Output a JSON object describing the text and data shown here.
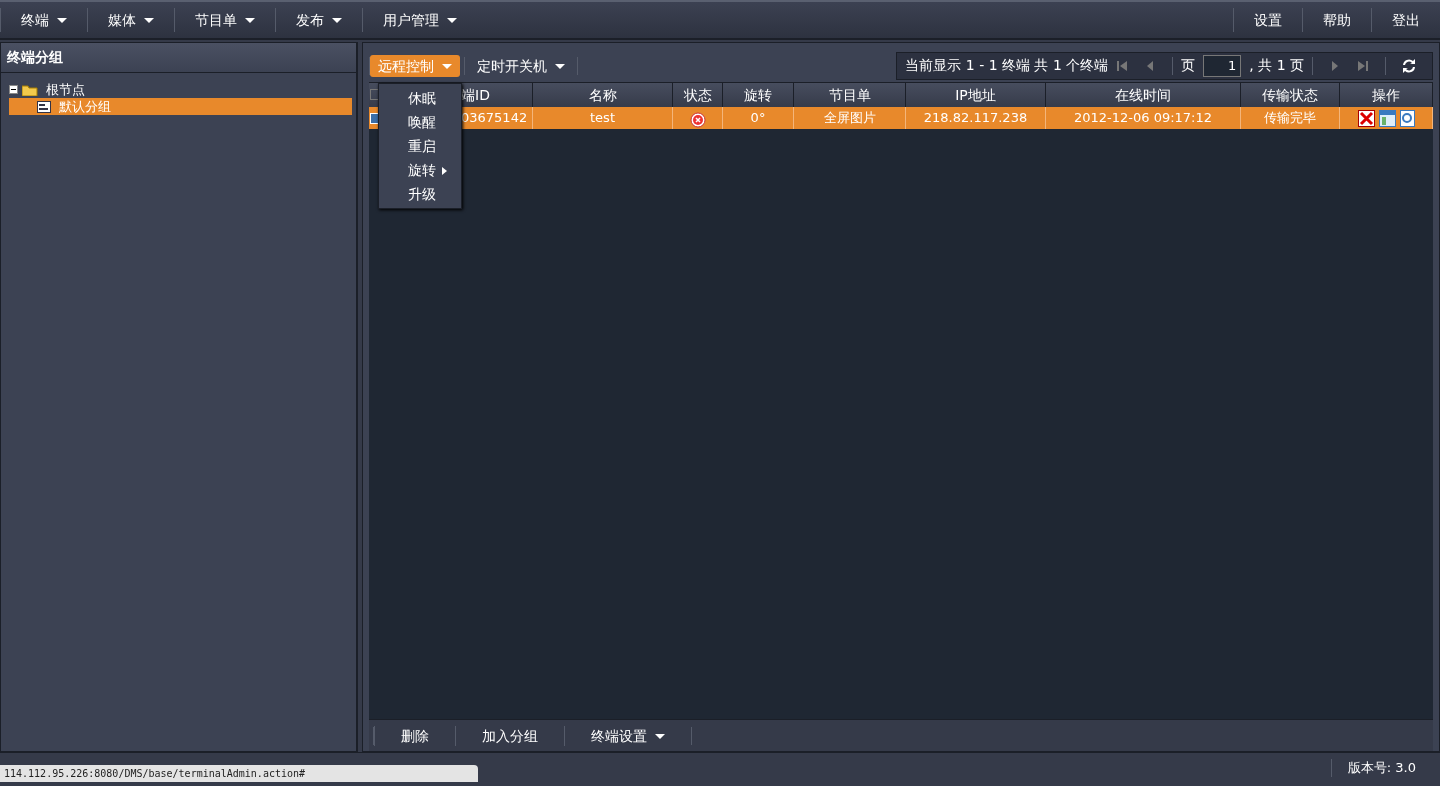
{
  "nav": {
    "menus": [
      {
        "label": "终端"
      },
      {
        "label": "媒体"
      },
      {
        "label": "节目单"
      },
      {
        "label": "发布"
      },
      {
        "label": "用户管理"
      }
    ],
    "links": [
      "设置",
      "帮助",
      "登出"
    ]
  },
  "sidebar": {
    "title": "终端分组",
    "tree": [
      {
        "label": "根节点",
        "expanded": true,
        "selected": false,
        "children": [
          {
            "label": "默认分组",
            "selected": true
          }
        ]
      }
    ]
  },
  "toolbar": {
    "buttons": [
      {
        "label": "远程控制",
        "selected": true
      },
      {
        "label": "定时开关机",
        "selected": false
      }
    ],
    "paging_info": "当前显示 1 - 1 终端 共 1 个终端",
    "page_label": "页",
    "page_value": "1",
    "page_total": ", 共 1 页"
  },
  "dropdown": {
    "items": [
      {
        "label": "休眠",
        "submenu": false
      },
      {
        "label": "唤醒",
        "submenu": false
      },
      {
        "label": "重启",
        "submenu": false
      },
      {
        "label": "旋转",
        "submenu": true
      },
      {
        "label": "升级",
        "submenu": false
      }
    ]
  },
  "table": {
    "select_all_checked": false,
    "columns": [
      "端ID",
      "名称",
      "状态",
      "旋转",
      "节目单",
      "IP地址",
      "在线时间",
      "传输状态",
      "操作"
    ],
    "rows": [
      {
        "checked": true,
        "selected": true,
        "id": "03675142",
        "name": "test",
        "online": false,
        "rotation": "0°",
        "playlist": "全屏图片",
        "ip": "218.82.117.238",
        "online_time": "2012-12-06 09:17:12",
        "transfer": "传输完毕"
      }
    ]
  },
  "bottom_toolbar": {
    "buttons": [
      {
        "label": "删除",
        "caret": false
      },
      {
        "label": "加入分组",
        "caret": false
      },
      {
        "label": "终端设置",
        "caret": true
      }
    ]
  },
  "footer": {
    "version": "版本号: 3.0"
  },
  "status_url": "114.112.95.226:8080/DMS/base/terminalAdmin.action#"
}
